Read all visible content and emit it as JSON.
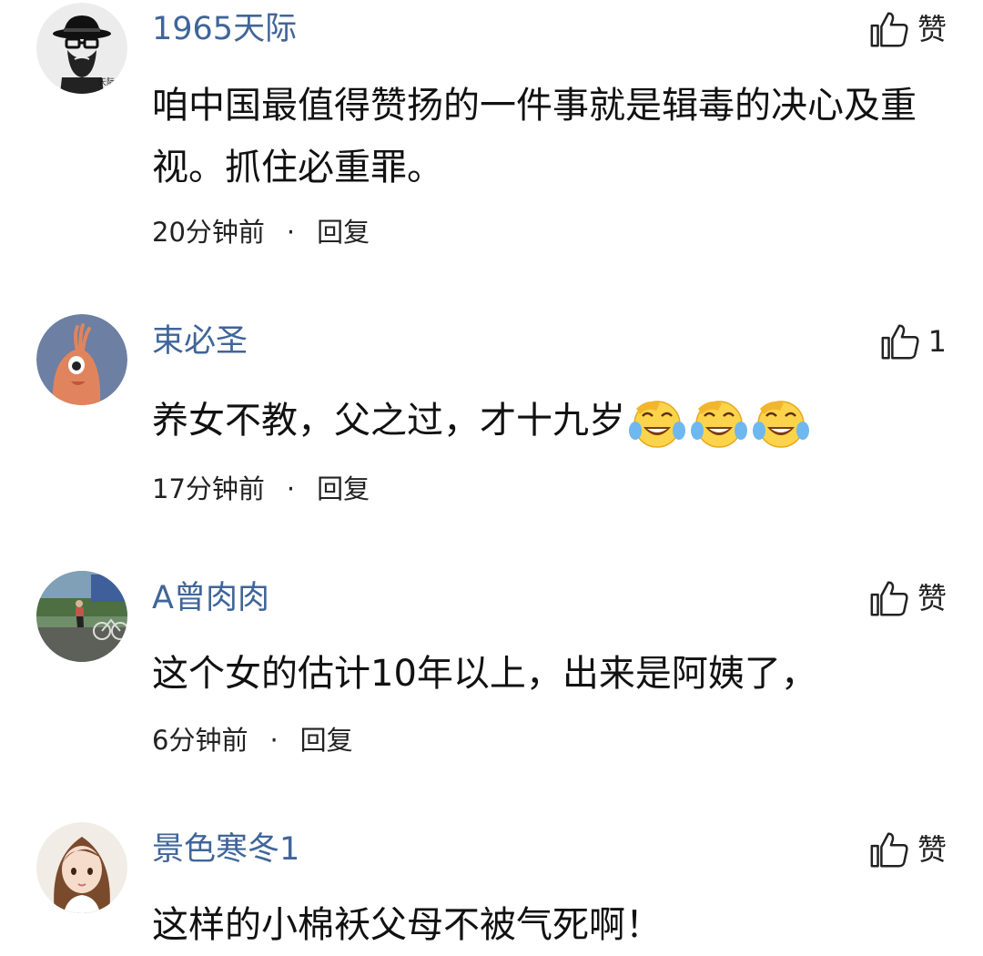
{
  "comments": [
    {
      "username": "1965天际",
      "like_label": "赞",
      "text": "咱中国最值得赞扬的一件事就是辑毒的决心及重视。抓住必重罪。",
      "time": "20分钟前",
      "dot": "·",
      "reply": "回复",
      "avatar_badge": "天际"
    },
    {
      "username": "束必圣",
      "like_label": "1",
      "text": "养女不教，父之过，才十九岁",
      "emoji": [
        "laughing-crying-emoji",
        "laughing-crying-emoji",
        "laughing-crying-emoji"
      ],
      "time": "17分钟前",
      "dot": "·",
      "reply": "回复"
    },
    {
      "username": "A曾肉肉",
      "like_label": "赞",
      "text": "这个女的估计10年以上，出来是阿姨了，",
      "time": "6分钟前",
      "dot": "·",
      "reply": "回复"
    },
    {
      "username": "景色寒冬1",
      "like_label": "赞",
      "text": "这样的小棉袄父母不被气死啊！"
    }
  ],
  "colors": {
    "username": "#406599",
    "text": "#111111",
    "meta": "#222222",
    "background": "#ffffff"
  }
}
